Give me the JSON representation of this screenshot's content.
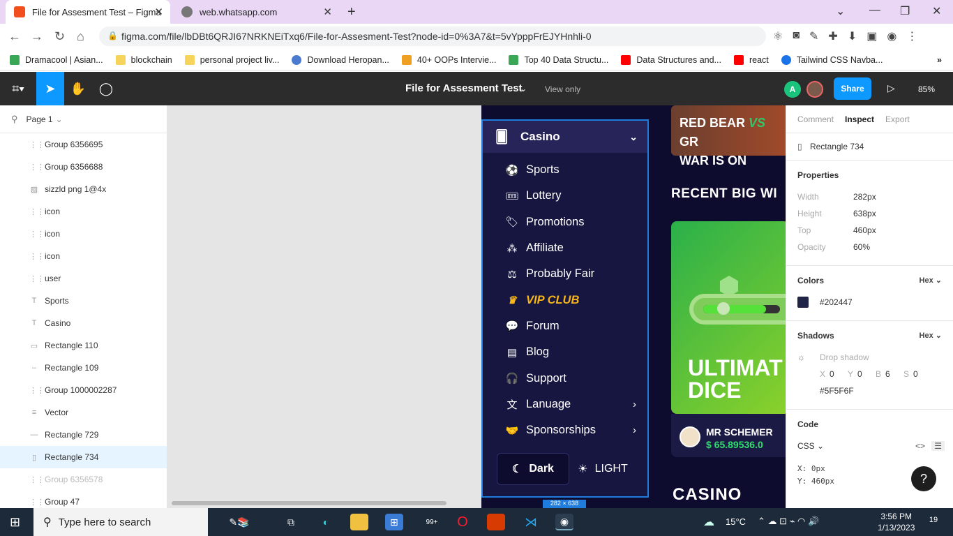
{
  "browser": {
    "tabs": [
      {
        "title": "File for Assesment Test – Figma",
        "active": true,
        "favicon_color": "#f24e1e"
      },
      {
        "title": "web.whatsapp.com",
        "active": false,
        "favicon_color": "#777777"
      }
    ],
    "url": "figma.com/file/lbDBt6QRJI67NRKNEiTxq6/File-for-Assesment-Test?node-id=0%3A7&t=5vYpppFrEJYHnhli-0",
    "bookmarks": [
      {
        "label": "Dramacool | Asian...",
        "color": "#3aa757"
      },
      {
        "label": "blockchain",
        "color": "#f6d35b"
      },
      {
        "label": "personal project liv...",
        "color": "#f6d35b"
      },
      {
        "label": "Download Heropan...",
        "color": "#4a7bd0"
      },
      {
        "label": "40+ OOPs Intervie...",
        "color": "#f0a020"
      },
      {
        "label": "Top 40 Data Structu...",
        "color": "#3aa757"
      },
      {
        "label": "Data Structures and...",
        "color": "#ff0000"
      },
      {
        "label": "react",
        "color": "#ff0000"
      },
      {
        "label": "Tailwind CSS Navba...",
        "color": "#1a73e8"
      }
    ]
  },
  "figma": {
    "file_title": "File for Assesment Test",
    "view_mode": "View only",
    "avatar_initial": "A",
    "share_label": "Share",
    "zoom": "85%",
    "page_name": "Page 1"
  },
  "layers": [
    {
      "name": "Group 6356695",
      "icon": "frame",
      "selected": false,
      "dim": false
    },
    {
      "name": "Group 6356688",
      "icon": "frame",
      "selected": false,
      "dim": false
    },
    {
      "name": "sizzld png 1@4x",
      "icon": "image",
      "selected": false,
      "dim": false
    },
    {
      "name": "icon",
      "icon": "frame",
      "selected": false,
      "dim": false
    },
    {
      "name": "icon",
      "icon": "frame",
      "selected": false,
      "dim": false
    },
    {
      "name": "icon",
      "icon": "frame",
      "selected": false,
      "dim": false
    },
    {
      "name": "user",
      "icon": "frame",
      "selected": false,
      "dim": false
    },
    {
      "name": "Sports",
      "icon": "text",
      "selected": false,
      "dim": false
    },
    {
      "name": "Casino",
      "icon": "text",
      "selected": false,
      "dim": false
    },
    {
      "name": "Rectangle 110",
      "icon": "rect",
      "selected": false,
      "dim": false
    },
    {
      "name": "Rectangle 109",
      "icon": "dashed",
      "selected": false,
      "dim": false
    },
    {
      "name": "Group 1000002287",
      "icon": "frame",
      "selected": false,
      "dim": false
    },
    {
      "name": "Vector",
      "icon": "vector",
      "selected": false,
      "dim": false
    },
    {
      "name": "Rectangle 729",
      "icon": "line",
      "selected": false,
      "dim": false
    },
    {
      "name": "Rectangle 734",
      "icon": "rect-tall",
      "selected": true,
      "dim": false
    },
    {
      "name": "Group 6356578",
      "icon": "frame",
      "selected": false,
      "dim": true
    },
    {
      "name": "Group 47",
      "icon": "frame",
      "selected": false,
      "dim": false
    }
  ],
  "design": {
    "menu_header": "Casino",
    "menu_items": [
      {
        "label": "Sports",
        "icon": "sports-icon",
        "vip": false,
        "has_arrow": false
      },
      {
        "label": "Lottery",
        "icon": "lottery-icon",
        "vip": false,
        "has_arrow": false
      },
      {
        "label": "Promotions",
        "icon": "promotions-icon",
        "vip": false,
        "has_arrow": false
      },
      {
        "label": "Affiliate",
        "icon": "affiliate-icon",
        "vip": false,
        "has_arrow": false
      },
      {
        "label": "Probably Fair",
        "icon": "fair-icon",
        "vip": false,
        "has_arrow": false
      },
      {
        "label": "VIP CLUB",
        "icon": "crown-icon",
        "vip": true,
        "has_arrow": false
      },
      {
        "label": "Forum",
        "icon": "forum-icon",
        "vip": false,
        "has_arrow": false
      },
      {
        "label": "Blog",
        "icon": "blog-icon",
        "vip": false,
        "has_arrow": false
      },
      {
        "label": "Support",
        "icon": "headset-icon",
        "vip": false,
        "has_arrow": false
      },
      {
        "label": "Lanuage",
        "icon": "language-icon",
        "vip": false,
        "has_arrow": true
      },
      {
        "label": "Sponsorships",
        "icon": "handshake-icon",
        "vip": false,
        "has_arrow": true
      }
    ],
    "theme_dark": "Dark",
    "theme_light": "LIGHT",
    "size_label": "282 × 638",
    "banner_line1_a": "RED BEAR",
    "banner_vs": "VS",
    "banner_line1_b": "GR",
    "banner_line2": "WAR IS ON",
    "recent_title": "RECENT BIG WI",
    "dice_title_1": "ULTIMAT",
    "dice_title_2": "DICE",
    "winner_name": "MR SCHEMER",
    "winner_amount": "$ 65.89536.0",
    "casino_title": "CASINO"
  },
  "inspect": {
    "tabs": [
      "Comment",
      "Inspect",
      "Export"
    ],
    "active_tab": "Inspect",
    "layer_name": "Rectangle 734",
    "properties_title": "Properties",
    "properties": [
      {
        "key": "Width",
        "value": "282px"
      },
      {
        "key": "Height",
        "value": "638px"
      },
      {
        "key": "Top",
        "value": "460px"
      },
      {
        "key": "Opacity",
        "value": "60%"
      }
    ],
    "colors_title": "Colors",
    "color_format": "Hex",
    "color_value": "#202447",
    "shadows_title": "Shadows",
    "shadow_format": "Hex",
    "shadow_type": "Drop shadow",
    "shadow_params": [
      {
        "k": "X",
        "v": "0"
      },
      {
        "k": "Y",
        "v": "0"
      },
      {
        "k": "B",
        "v": "6"
      },
      {
        "k": "S",
        "v": "0"
      }
    ],
    "shadow_color": "#5F5F6F",
    "code_title": "Code",
    "code_lang": "CSS",
    "code_lines": [
      "X: 0px",
      "Y: 460px"
    ]
  },
  "taskbar": {
    "search_placeholder": "Type here to search",
    "temperature": "15°C",
    "time": "3:56 PM",
    "date": "1/13/2023",
    "mail_badge": "99+",
    "notif_count": "19"
  }
}
